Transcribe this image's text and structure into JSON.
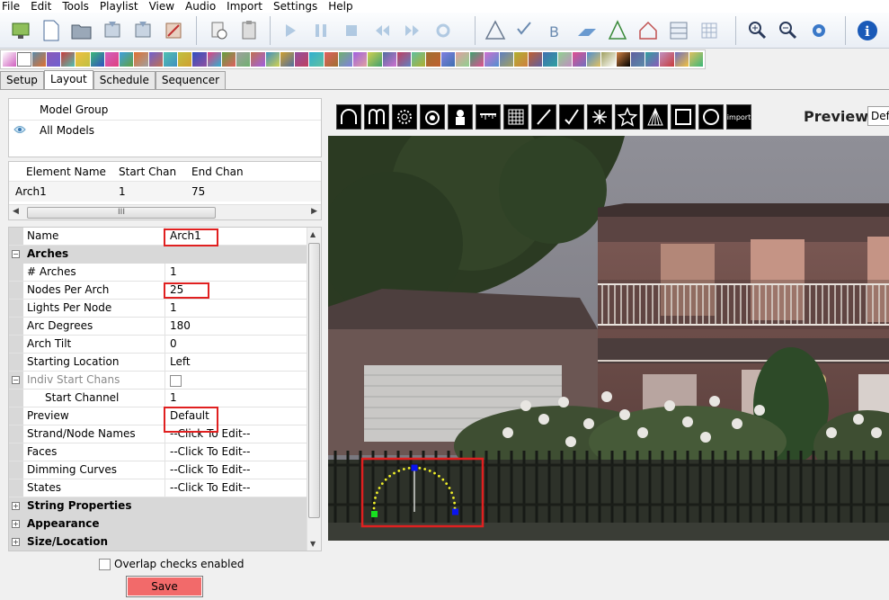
{
  "menu": [
    "File",
    "Edit",
    "Tools",
    "Playlist",
    "View",
    "Audio",
    "Import",
    "Settings",
    "Help"
  ],
  "tabs": [
    "Setup",
    "Layout",
    "Schedule",
    "Sequencer"
  ],
  "model_group": {
    "header": "Model Group",
    "items": [
      "All Models"
    ]
  },
  "element_list": {
    "columns": [
      "Element Name",
      "Start Chan",
      "End Chan"
    ],
    "rows": [
      {
        "name": "Arch1",
        "start": "1",
        "end": "75"
      }
    ],
    "scroll_grip": "III"
  },
  "properties": {
    "name_label": "Name",
    "name_value": "Arch1",
    "arches_cat": "Arches",
    "arches_label": "# Arches",
    "arches_value": "1",
    "nodes_label": "Nodes Per Arch",
    "nodes_value": "25",
    "lights_label": "Lights Per Node",
    "lights_value": "1",
    "degrees_label": "Arc Degrees",
    "degrees_value": "180",
    "tilt_label": "Arch Tilt",
    "tilt_value": "0",
    "startloc_label": "Starting Location",
    "startloc_value": "Left",
    "indiv_label": "Indiv Start Chans",
    "startchan_label": "Start Channel",
    "startchan_value": "1",
    "preview_label": "Preview",
    "preview_value": "Default",
    "strand_label": "Strand/Node Names",
    "strand_value": "--Click To Edit--",
    "faces_label": "Faces",
    "faces_value": "--Click To Edit--",
    "dimming_label": "Dimming Curves",
    "dimming_value": "--Click To Edit--",
    "states_label": "States",
    "states_value": "--Click To Edit--",
    "string_cat": "String Properties",
    "appearance_cat": "Appearance",
    "size_cat": "Size/Location"
  },
  "overlap_label": "Overlap checks enabled",
  "save_label": "Save",
  "preview": {
    "label": "Preview:",
    "selected": "Def"
  },
  "import_label": "import",
  "colors": {
    "highlight": "#e02020",
    "save_button": "#f26a6a",
    "node_dot": "#f0f028",
    "handle_blue": "#0a14f0",
    "handle_green": "#18e020"
  },
  "icons": {
    "toolbar": [
      "new-preview-icon",
      "new-file-icon",
      "open-icon",
      "save-icon",
      "save-as-icon",
      "clean-icon",
      "schedule-icon",
      "paste-icon",
      "play-icon",
      "pause-icon",
      "stop-icon",
      "rewind-icon",
      "fast-forward-icon",
      "loop-icon",
      "triangle-icon",
      "wand-icon",
      "rename-icon",
      "flat-icon",
      "tree-icon",
      "house-icon",
      "grid-icon",
      "matrix-icon",
      "zoom-in-icon",
      "zoom-out-icon",
      "settings-icon",
      "info-icon"
    ],
    "shapes": [
      "arch-icon",
      "candy-cane-icon",
      "circle-icon",
      "wreath-icon",
      "star-figure-icon",
      "icicles-icon",
      "matrix-icon",
      "line-icon",
      "polyline-icon",
      "spinner-icon",
      "star-icon",
      "tree-icon",
      "square-icon",
      "ring-icon",
      "import-icon"
    ]
  }
}
